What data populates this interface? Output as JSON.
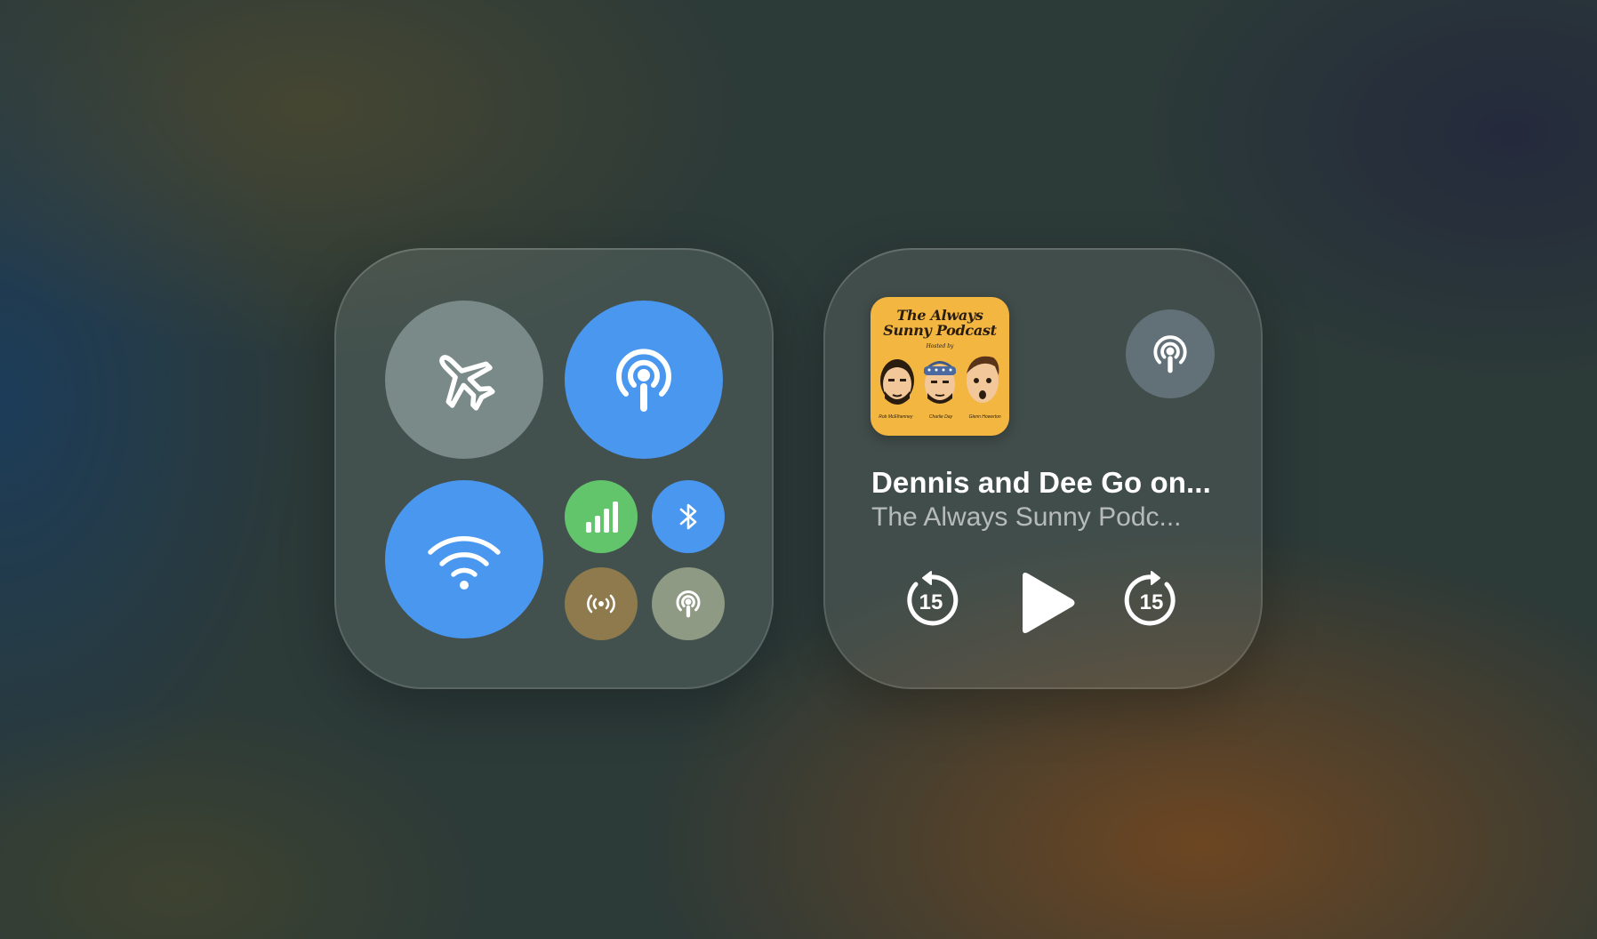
{
  "colors": {
    "blue_active": "#4a97ef",
    "gray_inactive": "#7a8a88",
    "green_cellular": "#62c56c",
    "hotspot_tan": "#8e7a4c",
    "focus_sage": "#8f9a84",
    "artwork_yellow": "#f3b640"
  },
  "connectivity": {
    "airplane": {
      "icon": "airplane-icon",
      "state": "off"
    },
    "airdrop": {
      "icon": "airdrop-icon",
      "state": "on"
    },
    "wifi": {
      "icon": "wifi-icon",
      "state": "on"
    },
    "cellular": {
      "icon": "cellular-bars-icon",
      "state": "on"
    },
    "bluetooth": {
      "icon": "bluetooth-icon",
      "state": "on"
    },
    "hotspot": {
      "icon": "hotspot-icon",
      "state": "off"
    },
    "focus": {
      "icon": "podcast-icon",
      "state": "off"
    }
  },
  "now_playing": {
    "artwork": {
      "title_line1": "The Always",
      "title_line2": "Sunny Podcast",
      "hosted_by": "Hosted by",
      "hosts": [
        "Rob McElhenney",
        "Charlie Day",
        "Glenn Howerton"
      ]
    },
    "title": "Dennis and Dee Go on...",
    "subtitle": "The Always Sunny Podc...",
    "skip_back_seconds": "15",
    "skip_forward_seconds": "15",
    "airplay_icon": "podcast-icon"
  }
}
